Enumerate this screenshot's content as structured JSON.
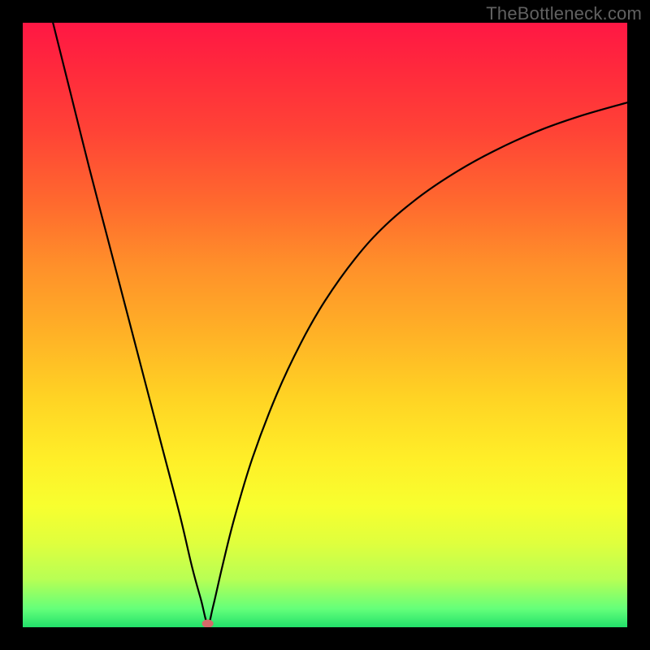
{
  "watermark": "TheBottleneck.com",
  "colors": {
    "frame_border": "#000000",
    "curve": "#000000",
    "marker": "#d66a6a",
    "gradient_top": "#ff1744",
    "gradient_bottom": "#22e06a"
  },
  "chart_data": {
    "type": "line",
    "title": "",
    "xlabel": "",
    "ylabel": "",
    "xlim": [
      0,
      100
    ],
    "ylim": [
      0,
      100
    ],
    "grid": false,
    "series": [
      {
        "name": "bottleneck-curve",
        "x": [
          5,
          8,
          11,
          14,
          17,
          20,
          23,
          26,
          28,
          29.5,
          30.6,
          31.5,
          33,
          35,
          38,
          42,
          46,
          50,
          55,
          60,
          66,
          72,
          78,
          85,
          92,
          100
        ],
        "y": [
          100,
          88,
          76,
          64.5,
          53,
          41.5,
          30,
          18.5,
          10,
          4.5,
          0.6,
          3.5,
          10,
          18,
          28,
          38.5,
          47,
          54,
          61,
          66.5,
          71.5,
          75.5,
          78.8,
          82,
          84.5,
          86.8
        ]
      }
    ],
    "marker": {
      "x": 30.6,
      "y": 0.6
    },
    "annotations": [
      {
        "text": "TheBottleneck.com",
        "position": "top-right"
      }
    ]
  }
}
